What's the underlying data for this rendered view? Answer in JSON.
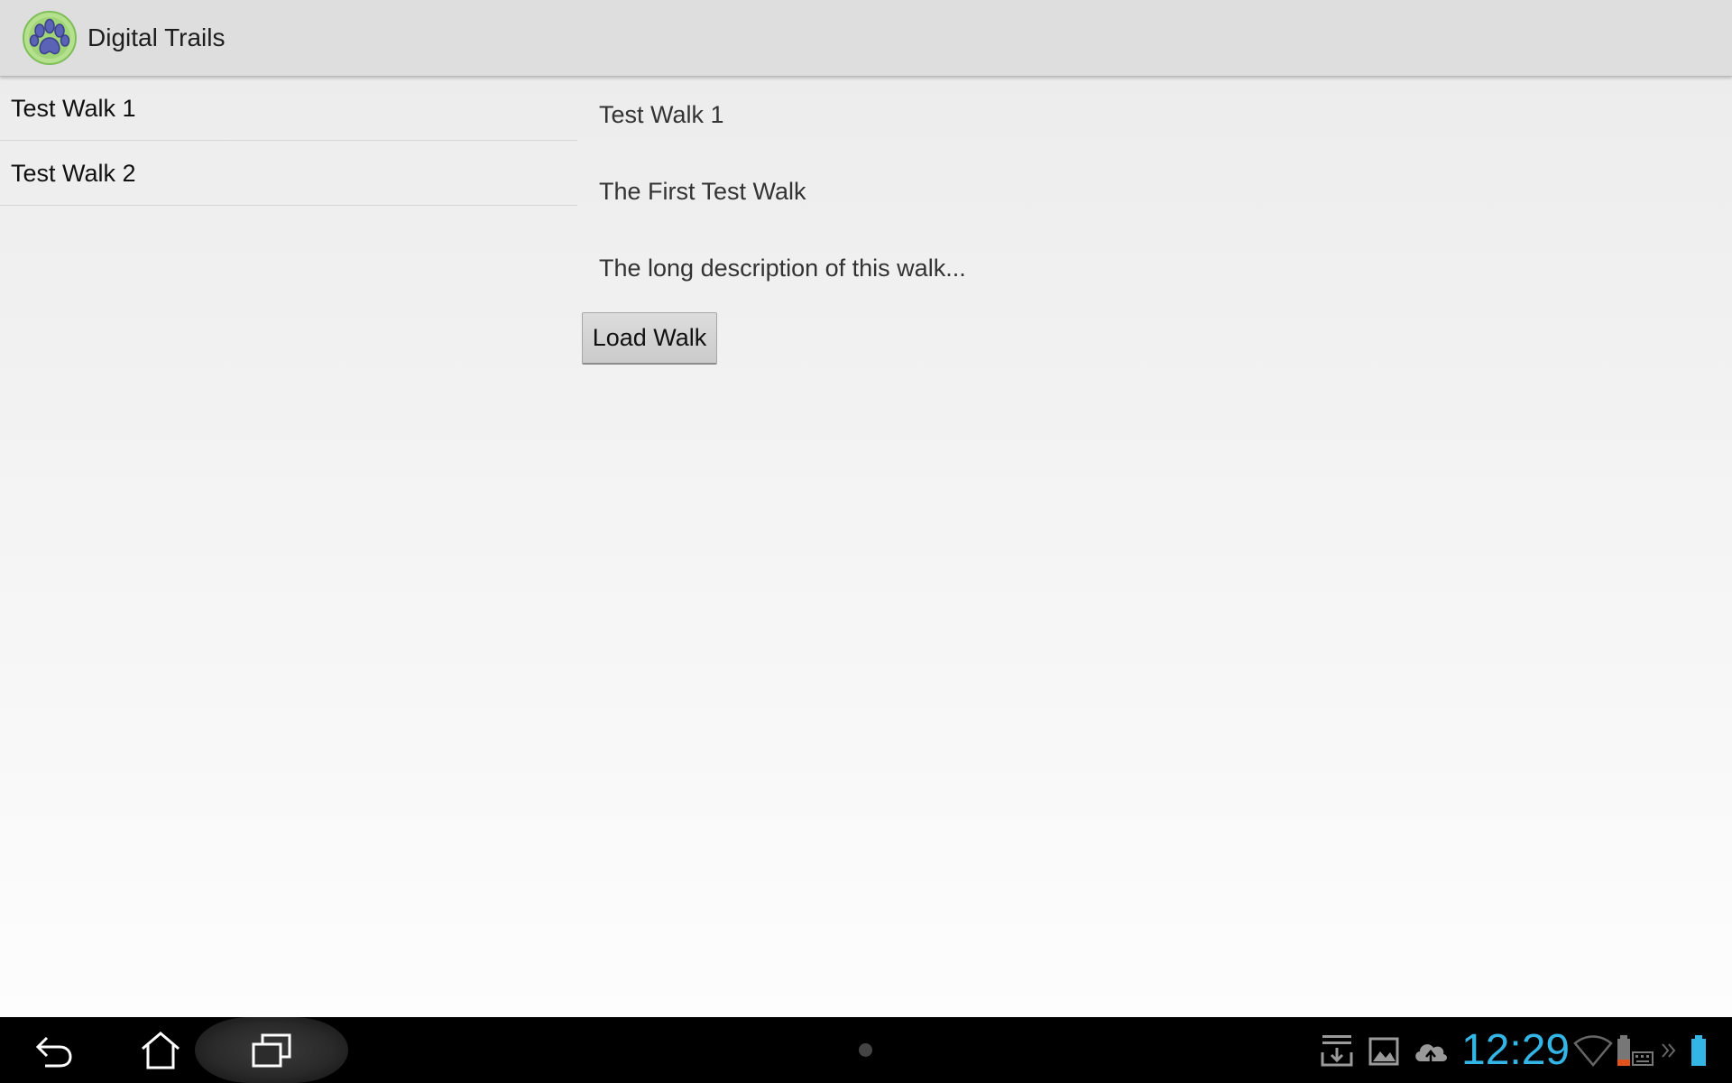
{
  "app": {
    "title": "Digital Trails",
    "icon": "paw-print-icon"
  },
  "walk_list": {
    "items": [
      {
        "label": "Test Walk 1"
      },
      {
        "label": "Test Walk 2"
      }
    ]
  },
  "detail": {
    "title": "Test Walk 1",
    "subtitle": "The First Test Walk",
    "description": "The long description of this walk...",
    "load_button_label": "Load Walk"
  },
  "system_bar": {
    "clock": "12:29",
    "clock_color": "#33b5e5",
    "nav_icons": [
      "back-icon",
      "home-icon",
      "recent-apps-icon"
    ],
    "status_icons": [
      "download-icon",
      "gallery-icon",
      "cloud-upload-icon",
      "wifi-icon",
      "battery-icon",
      "keyboard-icon",
      "more-icon"
    ]
  }
}
